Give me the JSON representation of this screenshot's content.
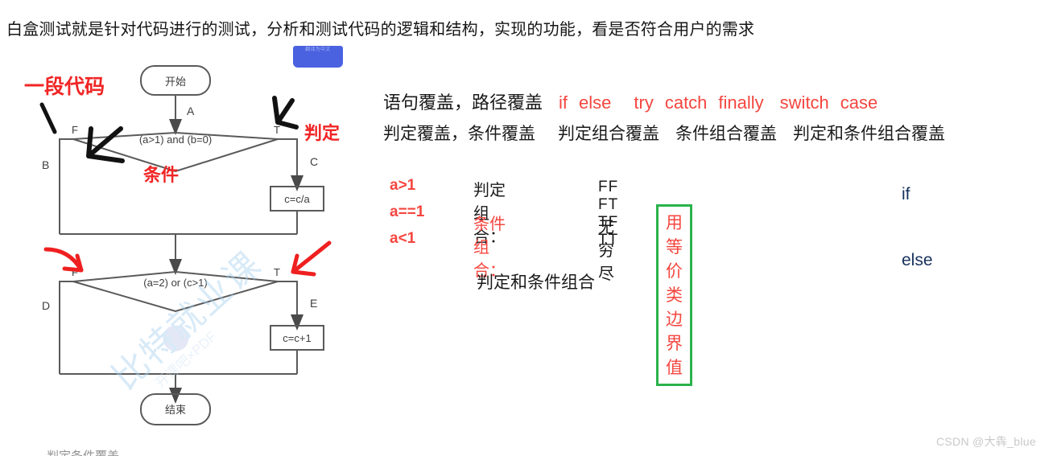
{
  "heading": "白盒测试就是针对代码进行的测试，分析和测试代码的逻辑和结构，实现的功能，看是否符合用户的需求",
  "blue_chip": {
    "text": "翻译为中文"
  },
  "flowchart": {
    "start_label": "开始",
    "end_label": "结束",
    "decision1": "(a>1) and (b=0)",
    "decision2": "(a=2) or (c>1)",
    "process1": "c=c/a",
    "process2": "c=c+1",
    "edge_a": "A",
    "edge_b": "B",
    "edge_c": "C",
    "edge_d": "D",
    "edge_e": "E",
    "d1_false": "F",
    "d1_true": "T",
    "d2_false": "F",
    "d2_true": "T"
  },
  "annotations": {
    "code_segment": "一段代码",
    "judgement": "判定",
    "condition": "条件"
  },
  "coverage": {
    "line1_cn": "语句覆盖，路径覆盖",
    "line1_kw1": "if",
    "line1_kw2": "else",
    "line1_kw3": "try",
    "line1_kw4": "catch",
    "line1_kw5": "finally",
    "line1_kw6": "switch",
    "line1_kw7": "case",
    "line2_a": "判定覆盖，条件覆盖",
    "line2_b": "判定组合覆盖",
    "line2_c": "条件组合覆盖",
    "line2_d": "判定和条件组合覆盖"
  },
  "conditions": {
    "c1": "a>1",
    "c2": "a==1",
    "c3": "a<1"
  },
  "combos": {
    "judge_label": "判定组合：",
    "cond_label": "条件组合：",
    "bits": [
      "FF",
      "FT",
      "TF",
      "TT"
    ],
    "infinite": "无穷尽",
    "boxed": "用等价类 边界值",
    "judge_and_cond": "判定和条件组合",
    "box_color": "#2bb24c",
    "boxed_text_color": "#f4463f"
  },
  "branch_labels": {
    "if": "if",
    "else": "else"
  },
  "watermark": {
    "csdn": "CSDN @大犇_blue",
    "diagram": "比特就业课"
  },
  "bottom_cut_text": "判定条件覆盖"
}
